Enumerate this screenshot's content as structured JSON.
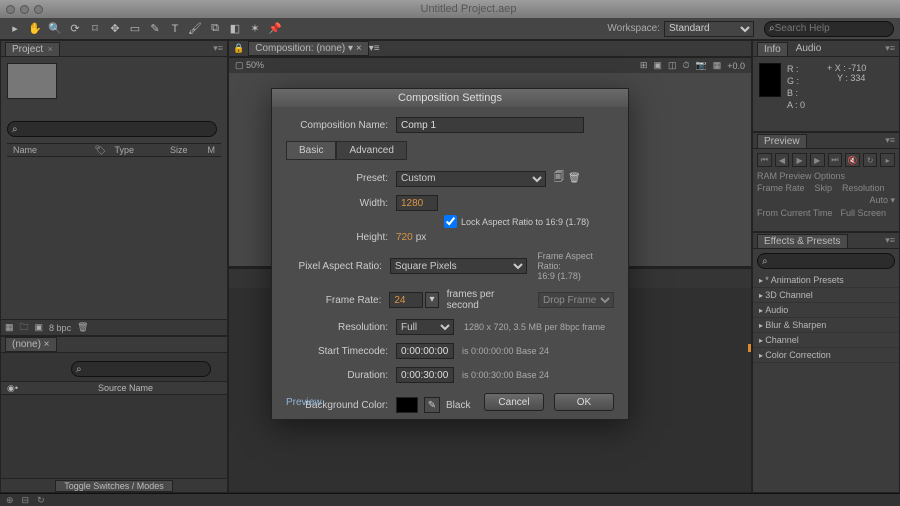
{
  "window": {
    "title": "Untitled Project.aep"
  },
  "toolbar": {
    "workspace_label": "Workspace:",
    "workspace_value": "Standard",
    "search_placeholder": "Search Help"
  },
  "project": {
    "tab": "Project",
    "cols": {
      "name": "Name",
      "type": "Type",
      "size": "Size",
      "m": "M"
    },
    "footer_bpc": "8 bpc"
  },
  "comp_viewer": {
    "tab": "Composition: (none)",
    "footer_zoom": "50%"
  },
  "info": {
    "tab1": "Info",
    "tab2": "Audio",
    "r": "R :",
    "g": "G :",
    "b": "B :",
    "a": "A : 0",
    "x": "X : -710",
    "y": "Y : 334",
    "plus": "+"
  },
  "preview": {
    "tab": "Preview",
    "ram": "RAM Preview Options",
    "fr": "Frame Rate",
    "skip": "Skip",
    "res": "Resolution",
    "auto": "Auto",
    "from": "From Current Time",
    "full": "Full Screen"
  },
  "effects": {
    "tab": "Effects & Presets",
    "items": [
      "* Animation Presets",
      "3D Channel",
      "Audio",
      "Blur & Sharpen",
      "Channel",
      "Color Correction"
    ]
  },
  "timeline": {
    "tab": "(none)",
    "col_source": "Source Name",
    "toggle": "Toggle Switches / Modes"
  },
  "statusbar": {
    "zoom": "+0.0"
  },
  "dialog": {
    "title": "Composition Settings",
    "name_label": "Composition Name:",
    "name_value": "Comp 1",
    "tab_basic": "Basic",
    "tab_advanced": "Advanced",
    "preset_label": "Preset:",
    "preset_value": "Custom",
    "width_label": "Width:",
    "width_value": "1280",
    "height_label": "Height:",
    "height_value": "720",
    "height_unit": "px",
    "lock_label": "Lock Aspect Ratio to 16:9 (1.78)",
    "par_label": "Pixel Aspect Ratio:",
    "par_value": "Square Pixels",
    "far_label": "Frame Aspect Ratio:",
    "far_value": "16:9 (1.78)",
    "fr_label": "Frame Rate:",
    "fr_value": "24",
    "fr_unit": "frames per second",
    "fr_drop": "Drop Frame",
    "res_label": "Resolution:",
    "res_value": "Full",
    "res_note": "1280 x 720, 3.5 MB per 8bpc frame",
    "tc_label": "Start Timecode:",
    "tc_value": "0:00:00:00",
    "tc_note": "is 0:00:00:00  Base 24",
    "dur_label": "Duration:",
    "dur_value": "0:00:30:00",
    "dur_note": "is 0:00:30:00  Base 24",
    "bg_label": "Background Color:",
    "bg_name": "Black",
    "preview": "Preview",
    "cancel": "Cancel",
    "ok": "OK"
  }
}
